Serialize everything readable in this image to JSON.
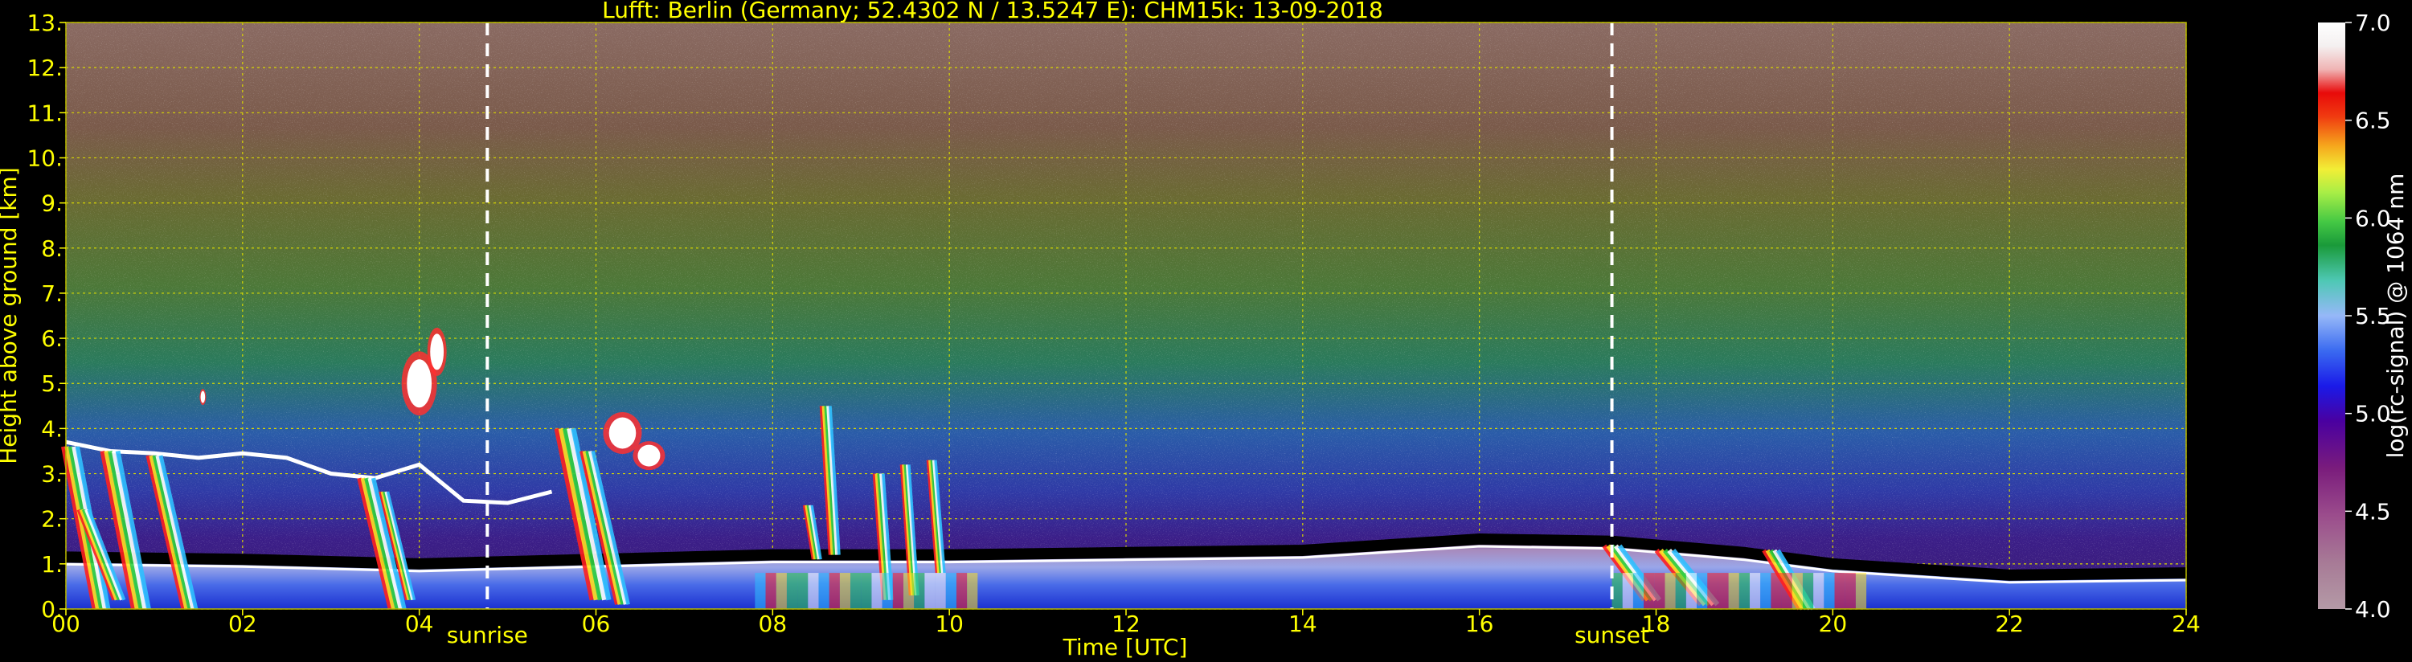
{
  "chart_data": {
    "type": "heatmap",
    "title": "Lufft: Berlin (Germany; 52.4302 N / 13.5247 E):    CHM15k: 13-09-2018",
    "xlabel": "Time [UTC]",
    "ylabel": "Height above ground [km]",
    "xlim": [
      0,
      24
    ],
    "ylim": [
      0,
      13
    ],
    "x_ticks": [
      "00",
      "02",
      "04",
      "06",
      "08",
      "10",
      "12",
      "14",
      "16",
      "18",
      "20",
      "22",
      "24"
    ],
    "y_ticks": [
      "0.",
      "1.",
      "2.",
      "3.",
      "4.",
      "5.",
      "6.",
      "7.",
      "8.",
      "9.",
      "10.",
      "11.",
      "12.",
      "13."
    ],
    "grid": true,
    "events": [
      {
        "label": "sunrise",
        "time": 4.77
      },
      {
        "label": "sunset",
        "time": 17.5
      }
    ],
    "colorbar": {
      "label": "log(rc-signal) @ 1064 nm",
      "range": [
        4.0,
        7.0
      ],
      "ticks": [
        "4.0",
        "4.5",
        "5.0",
        "5.5",
        "6.0",
        "6.5",
        "7.0"
      ]
    },
    "features": {
      "boundary_layer_top_km": [
        [
          0.0,
          1.15
        ],
        [
          2.0,
          1.1
        ],
        [
          4.0,
          1.0
        ],
        [
          6.0,
          1.1
        ],
        [
          8.0,
          1.2
        ],
        [
          10.0,
          1.2
        ],
        [
          12.0,
          1.25
        ],
        [
          14.0,
          1.3
        ],
        [
          16.0,
          1.55
        ],
        [
          17.5,
          1.5
        ],
        [
          19.0,
          1.25
        ],
        [
          20.0,
          1.0
        ],
        [
          22.0,
          0.75
        ],
        [
          24.0,
          0.8
        ]
      ],
      "cloud_layer_km": [
        [
          0.0,
          3.7
        ],
        [
          0.5,
          3.5
        ],
        [
          1.0,
          3.45
        ],
        [
          1.5,
          3.35
        ],
        [
          2.0,
          3.45
        ],
        [
          2.5,
          3.35
        ],
        [
          3.0,
          3.0
        ],
        [
          3.5,
          2.9
        ],
        [
          4.0,
          3.2
        ],
        [
          4.5,
          2.4
        ],
        [
          5.0,
          2.35
        ],
        [
          5.5,
          2.6
        ]
      ]
    }
  }
}
